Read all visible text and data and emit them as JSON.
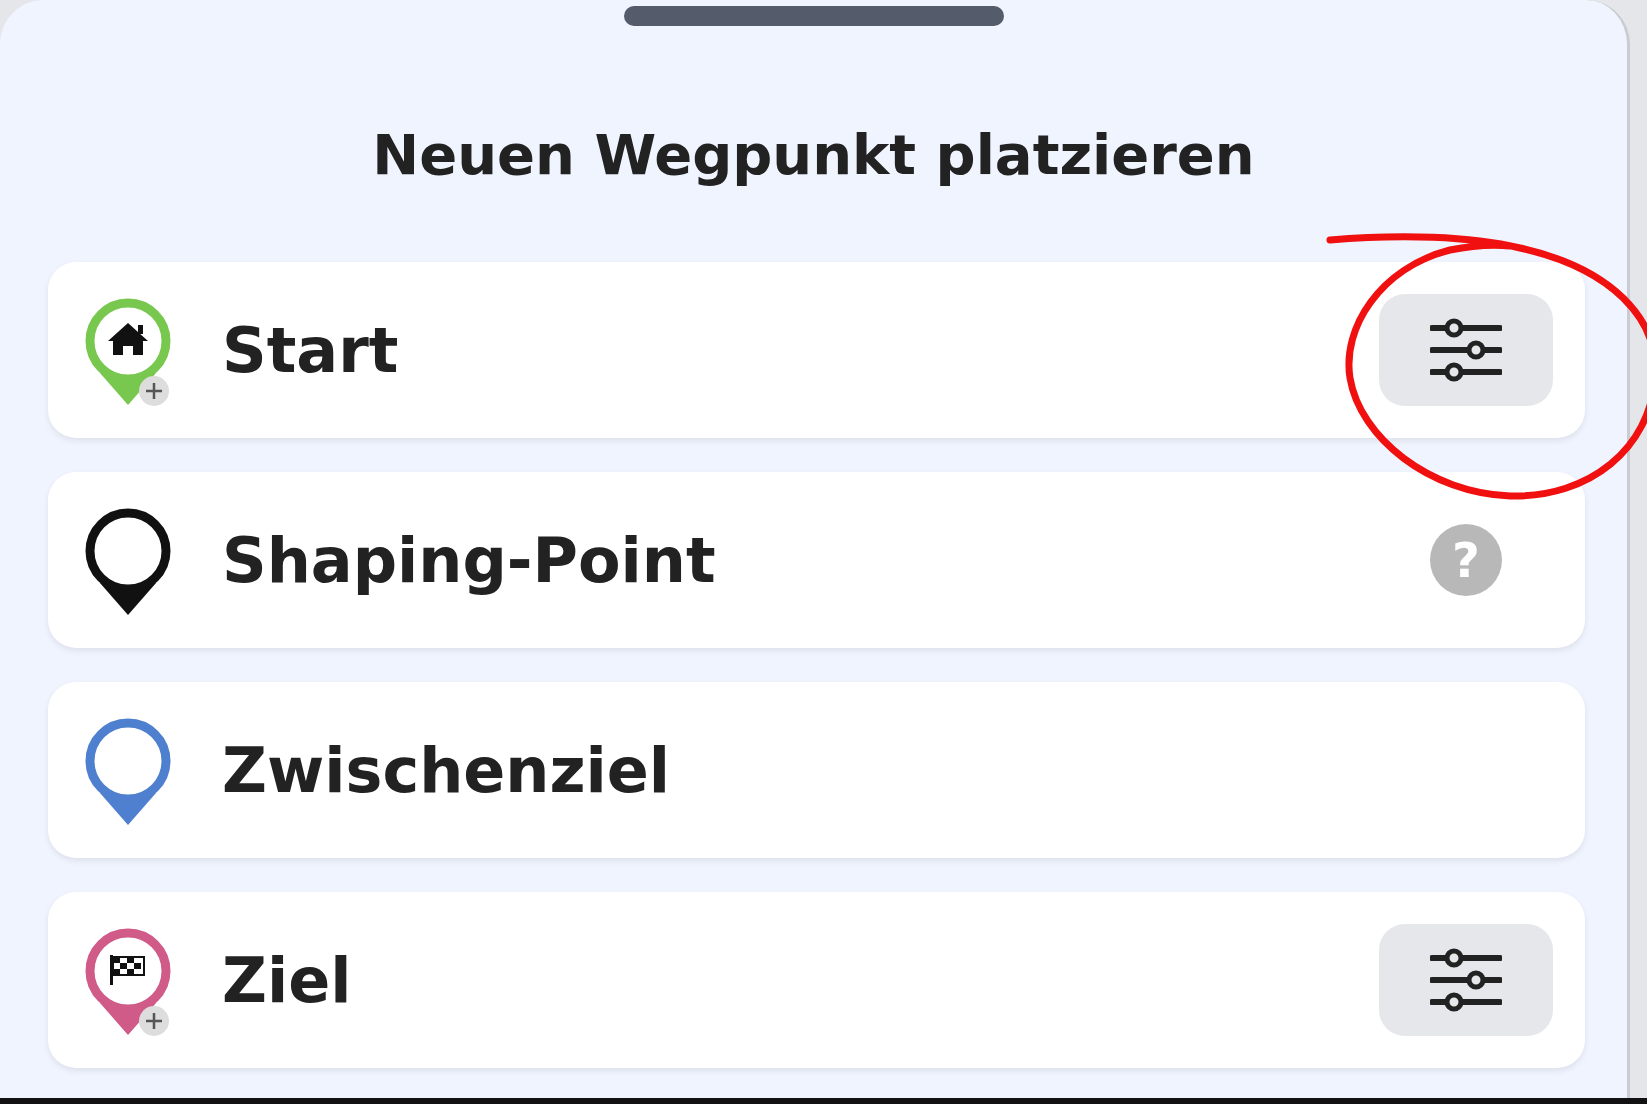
{
  "title": "Neuen Wegpunkt platzieren",
  "items": [
    {
      "label": "Start",
      "kind": "start",
      "color": "#78c850",
      "add_badge": true,
      "trailing": {
        "kind": "settings"
      }
    },
    {
      "label": "Shaping-Point",
      "kind": "plain",
      "color": "#111111",
      "add_badge": false,
      "trailing": {
        "kind": "help",
        "glyph": "?"
      }
    },
    {
      "label": "Zwischenziel",
      "kind": "plain",
      "color": "#4f7fcf",
      "add_badge": false
    },
    {
      "label": "Ziel",
      "kind": "finish",
      "color": "#d05a88",
      "add_badge": true,
      "trailing": {
        "kind": "settings"
      }
    }
  ]
}
